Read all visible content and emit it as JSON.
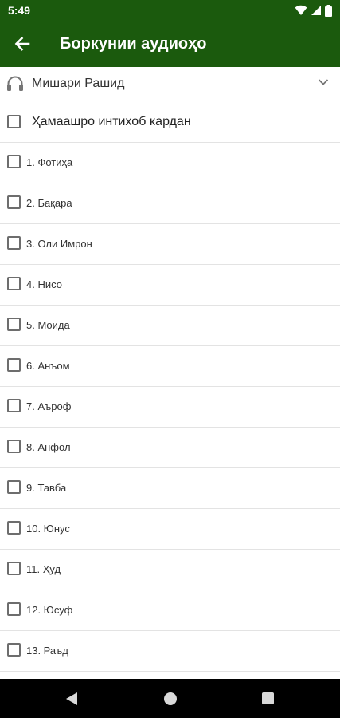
{
  "status_bar": {
    "time": "5:49",
    "icons": [
      "wifi-icon",
      "signal-icon",
      "battery-icon"
    ]
  },
  "app_bar": {
    "title": "Боркунии аудиоҳо",
    "back_icon": "arrow-left-icon",
    "background_color": "#1b5a0d"
  },
  "reciter": {
    "label": "Мишари Рашид",
    "icon": "headphones-icon",
    "dropdown_icon": "chevron-down-icon"
  },
  "select_all": {
    "label": "Ҳамаашро интихоб кардан",
    "checked": false
  },
  "surahs": [
    {
      "label": "1. Фотиҳа",
      "checked": false
    },
    {
      "label": "2. Бақара",
      "checked": false
    },
    {
      "label": "3. Оли Имрон",
      "checked": false
    },
    {
      "label": "4. Нисо",
      "checked": false
    },
    {
      "label": "5. Моида",
      "checked": false
    },
    {
      "label": "6. Анъом",
      "checked": false
    },
    {
      "label": "7. Аъроф",
      "checked": false
    },
    {
      "label": "8. Анфол",
      "checked": false
    },
    {
      "label": "9. Тавба",
      "checked": false
    },
    {
      "label": "10. Юнус",
      "checked": false
    },
    {
      "label": "11. Ҳуд",
      "checked": false
    },
    {
      "label": "12. Юсуф",
      "checked": false
    },
    {
      "label": "13. Раъд",
      "checked": false
    }
  ],
  "nav_bar": {
    "buttons": [
      "back-triangle-icon",
      "home-circle-icon",
      "recents-square-icon"
    ]
  }
}
